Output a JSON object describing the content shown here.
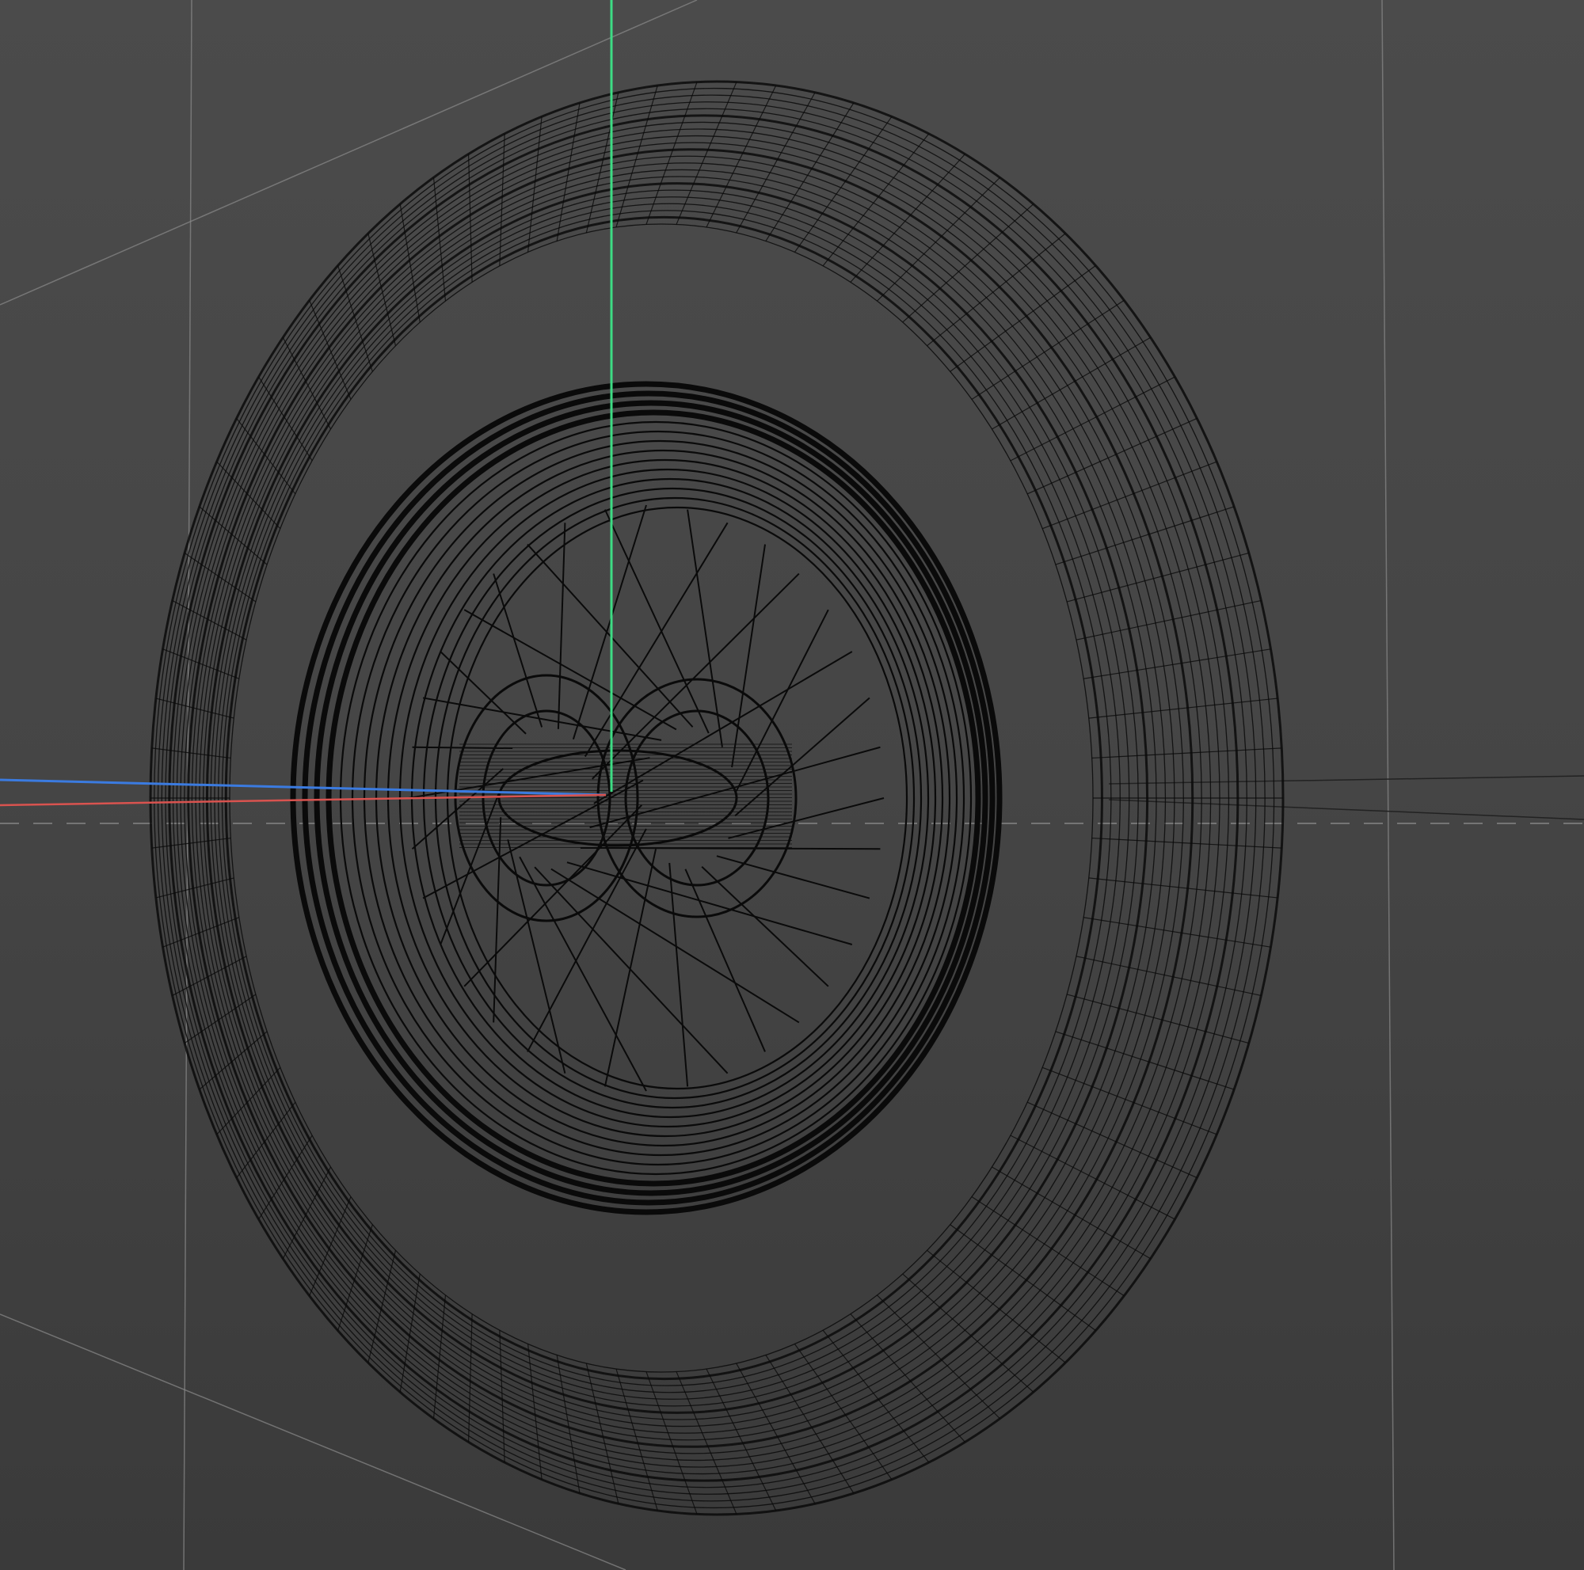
{
  "viewport": {
    "mode": "wireframe",
    "object": "wheel",
    "colors": {
      "background": "#474747",
      "wire": "#0a0a0a",
      "grid": "#8a8a8a",
      "axis_x": "#d9534f",
      "axis_y": "#3ddc84",
      "axis_z": "#3b7be0"
    }
  }
}
